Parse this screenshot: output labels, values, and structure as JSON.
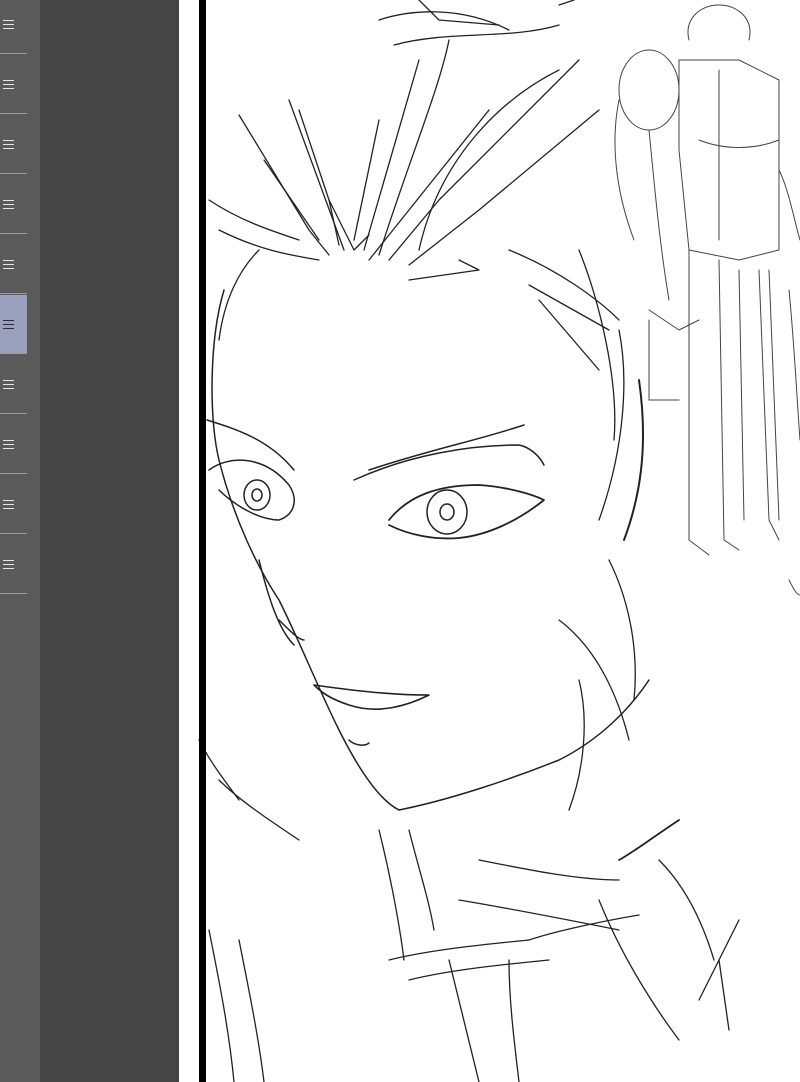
{
  "app": {
    "layers_panel": {
      "layer_count": 10,
      "selected_index": 5,
      "selected_color": "#9aa0bd",
      "handle_icon": "drag-handle-icon"
    },
    "canvas": {
      "background": "#ffffff",
      "artwork": "pencil-sketch"
    }
  }
}
